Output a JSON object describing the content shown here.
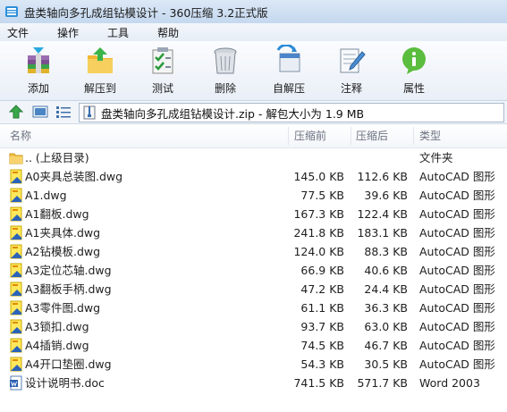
{
  "window": {
    "title": "盘类轴向多孔成组钻模设计 - 360压缩 3.2正式版"
  },
  "menu": [
    "文件",
    "操作",
    "工具",
    "帮助"
  ],
  "toolbar": {
    "add": "添加",
    "extract": "解压到",
    "test": "测试",
    "delete": "删除",
    "sfx": "自解压",
    "comment": "注释",
    "properties": "属性"
  },
  "path": {
    "text": "盘类轴向多孔成组钻模设计.zip - 解包大小为 1.9 MB"
  },
  "columns": {
    "name": "名称",
    "compressed": "压缩前",
    "after": "压缩后",
    "type": "类型"
  },
  "files": [
    {
      "name": ".. (上级目录)",
      "compressed": "",
      "after": "",
      "type": "文件夹",
      "icon": "folder-icon"
    },
    {
      "name": "A0夹具总装图.dwg",
      "compressed": "145.0 KB",
      "after": "112.6 KB",
      "type": "AutoCAD 图形",
      "icon": "dwg-icon"
    },
    {
      "name": "A1.dwg",
      "compressed": "77.5 KB",
      "after": "39.6 KB",
      "type": "AutoCAD 图形",
      "icon": "dwg-icon"
    },
    {
      "name": "A1翻板.dwg",
      "compressed": "167.3 KB",
      "after": "122.4 KB",
      "type": "AutoCAD 图形",
      "icon": "dwg-icon"
    },
    {
      "name": "A1夹具体.dwg",
      "compressed": "241.8 KB",
      "after": "183.1 KB",
      "type": "AutoCAD 图形",
      "icon": "dwg-icon"
    },
    {
      "name": "A2钻模板.dwg",
      "compressed": "124.0 KB",
      "after": "88.3 KB",
      "type": "AutoCAD 图形",
      "icon": "dwg-icon"
    },
    {
      "name": "A3定位芯轴.dwg",
      "compressed": "66.9 KB",
      "after": "40.6 KB",
      "type": "AutoCAD 图形",
      "icon": "dwg-icon"
    },
    {
      "name": "A3翻板手柄.dwg",
      "compressed": "47.2 KB",
      "after": "24.4 KB",
      "type": "AutoCAD 图形",
      "icon": "dwg-icon"
    },
    {
      "name": "A3零件图.dwg",
      "compressed": "61.1 KB",
      "after": "36.3 KB",
      "type": "AutoCAD 图形",
      "icon": "dwg-icon"
    },
    {
      "name": "A3锁扣.dwg",
      "compressed": "93.7 KB",
      "after": "63.0 KB",
      "type": "AutoCAD 图形",
      "icon": "dwg-icon"
    },
    {
      "name": "A4插销.dwg",
      "compressed": "74.5 KB",
      "after": "46.7 KB",
      "type": "AutoCAD 图形",
      "icon": "dwg-icon"
    },
    {
      "name": "A4开口垫圈.dwg",
      "compressed": "54.3 KB",
      "after": "30.5 KB",
      "type": "AutoCAD 图形",
      "icon": "dwg-icon"
    },
    {
      "name": "设计说明书.doc",
      "compressed": "741.5 KB",
      "after": "571.7 KB",
      "type": "Word 2003",
      "icon": "word-doc-icon"
    }
  ]
}
